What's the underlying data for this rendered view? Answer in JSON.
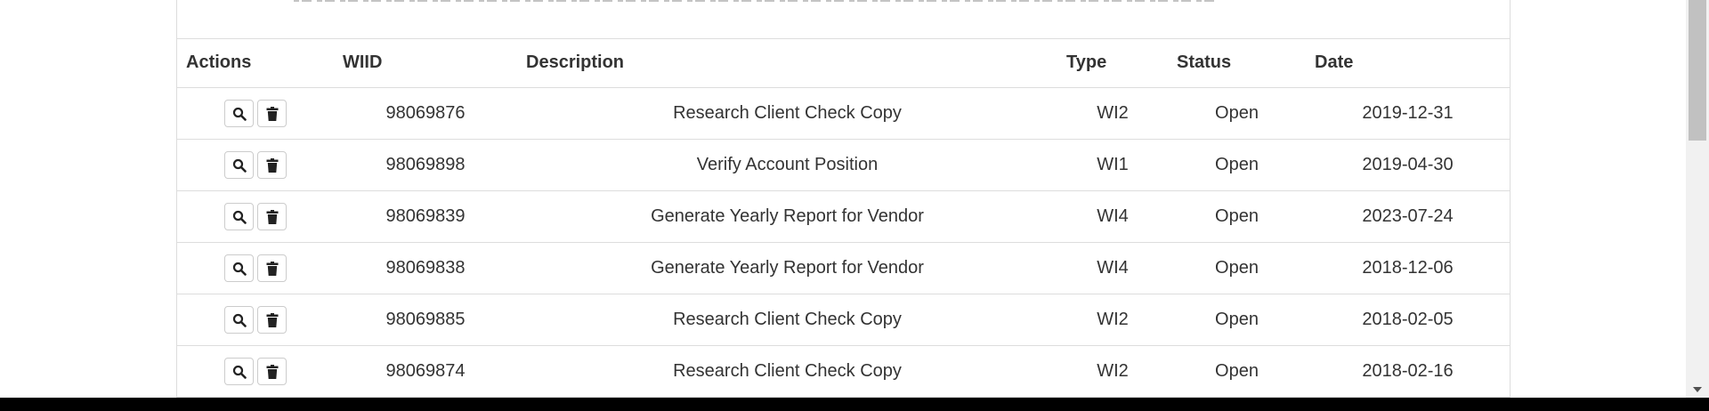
{
  "table": {
    "headers": {
      "actions": "Actions",
      "wiid": "WIID",
      "description": "Description",
      "type": "Type",
      "status": "Status",
      "date": "Date"
    },
    "rows": [
      {
        "wiid": "98069876",
        "description": "Research Client Check Copy",
        "type": "WI2",
        "status": "Open",
        "date": "2019-12-31"
      },
      {
        "wiid": "98069898",
        "description": "Verify Account Position",
        "type": "WI1",
        "status": "Open",
        "date": "2019-04-30"
      },
      {
        "wiid": "98069839",
        "description": "Generate Yearly Report for Vendor",
        "type": "WI4",
        "status": "Open",
        "date": "2023-07-24"
      },
      {
        "wiid": "98069838",
        "description": "Generate Yearly Report for Vendor",
        "type": "WI4",
        "status": "Open",
        "date": "2018-12-06"
      },
      {
        "wiid": "98069885",
        "description": "Research Client Check Copy",
        "type": "WI2",
        "status": "Open",
        "date": "2018-02-05"
      },
      {
        "wiid": "98069874",
        "description": "Research Client Check Copy",
        "type": "WI2",
        "status": "Open",
        "date": "2018-02-16"
      }
    ],
    "row_actions": [
      "search-icon",
      "trash-icon"
    ]
  }
}
